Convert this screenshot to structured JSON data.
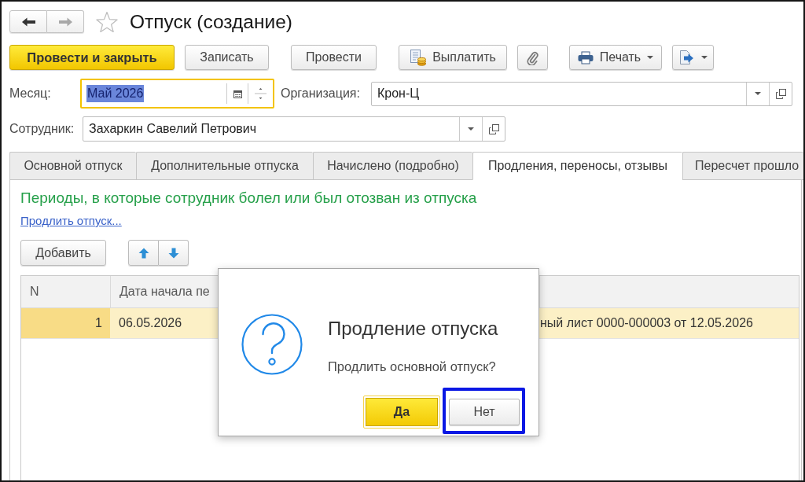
{
  "nav": {
    "buttons": [
      {
        "disabled": false
      },
      {
        "disabled": true
      }
    ],
    "favorite": false
  },
  "window": {
    "title": "Отпуск (создание)"
  },
  "toolbar": [
    {
      "label": "Провести и закрыть",
      "default": true,
      "menu": false
    },
    {
      "label": "Записать",
      "default": false,
      "menu": false
    },
    {
      "label": "Провести",
      "default": false,
      "menu": false
    },
    {
      "label": "Выплатить",
      "default": false,
      "menu": false
    },
    {
      "default": false,
      "menu": false
    },
    {
      "label": "Печать",
      "default": false,
      "menu": true
    },
    {
      "default": false,
      "menu": true
    }
  ],
  "fields": [
    {
      "kind": "period",
      "label": "Месяц:",
      "value": "Май 2026",
      "focused": true
    },
    {
      "kind": "reference",
      "label": "Организация:",
      "value": "Крон-Ц",
      "focused": false
    },
    {
      "kind": "reference",
      "label": "Сотрудник:",
      "value": "Захаркин Савелий Петрович",
      "focused": false
    }
  ],
  "tabs": [
    {
      "label": "Основной отпуск",
      "selected": false
    },
    {
      "label": "Дополнительные отпуска",
      "selected": false
    },
    {
      "label": "Начислено (подробно)",
      "selected": false
    },
    {
      "label": "Продления, переносы, отзывы",
      "selected": true
    },
    {
      "label": "Пересчет прошло",
      "selected": false
    }
  ],
  "panel": {
    "heading": "Периоды, в которые сотрудник болел или был отозван из отпуска",
    "link": "Продлить отпуск...",
    "add_button": "Добавить",
    "table": {
      "columns": [
        "N",
        "Дата начала пе"
      ],
      "rows": [
        {
          "selected": true,
          "cells": [
            "1",
            "06.05.2026",
            "ный лист 0000-000003 от 12.05.2026"
          ]
        }
      ]
    }
  },
  "dialog": {
    "title": "Продление отпуска",
    "message": "Продлить основной отпуск?",
    "buttons": [
      {
        "label": "Да",
        "default": true,
        "focused": true,
        "highlighted": false
      },
      {
        "label": "Нет",
        "default": false,
        "focused": false,
        "highlighted": true
      }
    ]
  }
}
